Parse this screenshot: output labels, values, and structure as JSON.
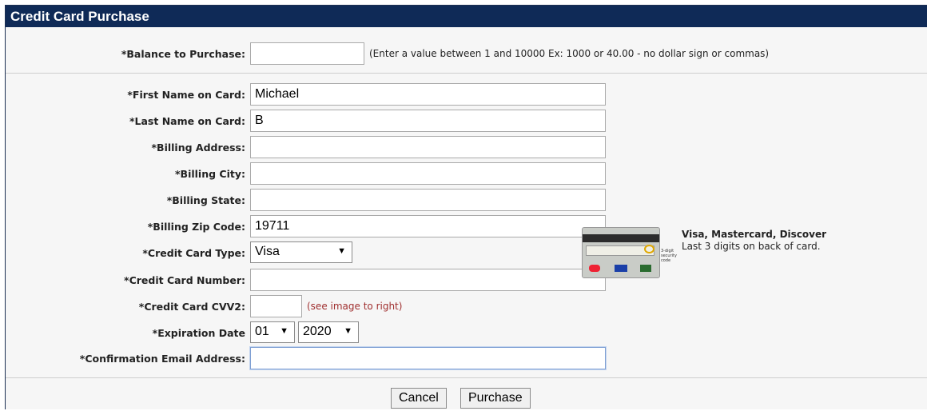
{
  "panel": {
    "title": "Credit Card Purchase"
  },
  "balance": {
    "label": "*Balance to Purchase:",
    "value": "",
    "hint": "(Enter a value between 1 and 10000 Ex: 1000 or 40.00 - no dollar sign or commas)"
  },
  "fields": {
    "first_name": {
      "label": "*First Name on Card:",
      "value": "Michael"
    },
    "last_name": {
      "label": "*Last Name on Card:",
      "value": "B"
    },
    "address": {
      "label": "*Billing Address:",
      "value": ""
    },
    "city": {
      "label": "*Billing City:",
      "value": ""
    },
    "state": {
      "label": "*Billing State:",
      "value": ""
    },
    "zip": {
      "label": "*Billing Zip Code:",
      "value": "19711"
    },
    "card_type": {
      "label": "*Credit Card Type:",
      "selected": "Visa"
    },
    "card_number": {
      "label": "*Credit Card Number:",
      "value": ""
    },
    "cvv2": {
      "label": "*Credit Card CVV2:",
      "value": "",
      "hint": "(see image to right)"
    },
    "expiration": {
      "label": "*Expiration Date",
      "month": "01",
      "year": "2020"
    },
    "email": {
      "label": "*Confirmation Email Address:",
      "value": ""
    }
  },
  "card_info": {
    "title": "Visa, Mastercard, Discover",
    "subtitle": "Last 3 digits on back of card.",
    "image_note": "3-digit security code"
  },
  "buttons": {
    "cancel": "Cancel",
    "purchase": "Purchase"
  },
  "colors": {
    "header_bg": "#0f2a57",
    "hint_red": "#a03030"
  }
}
